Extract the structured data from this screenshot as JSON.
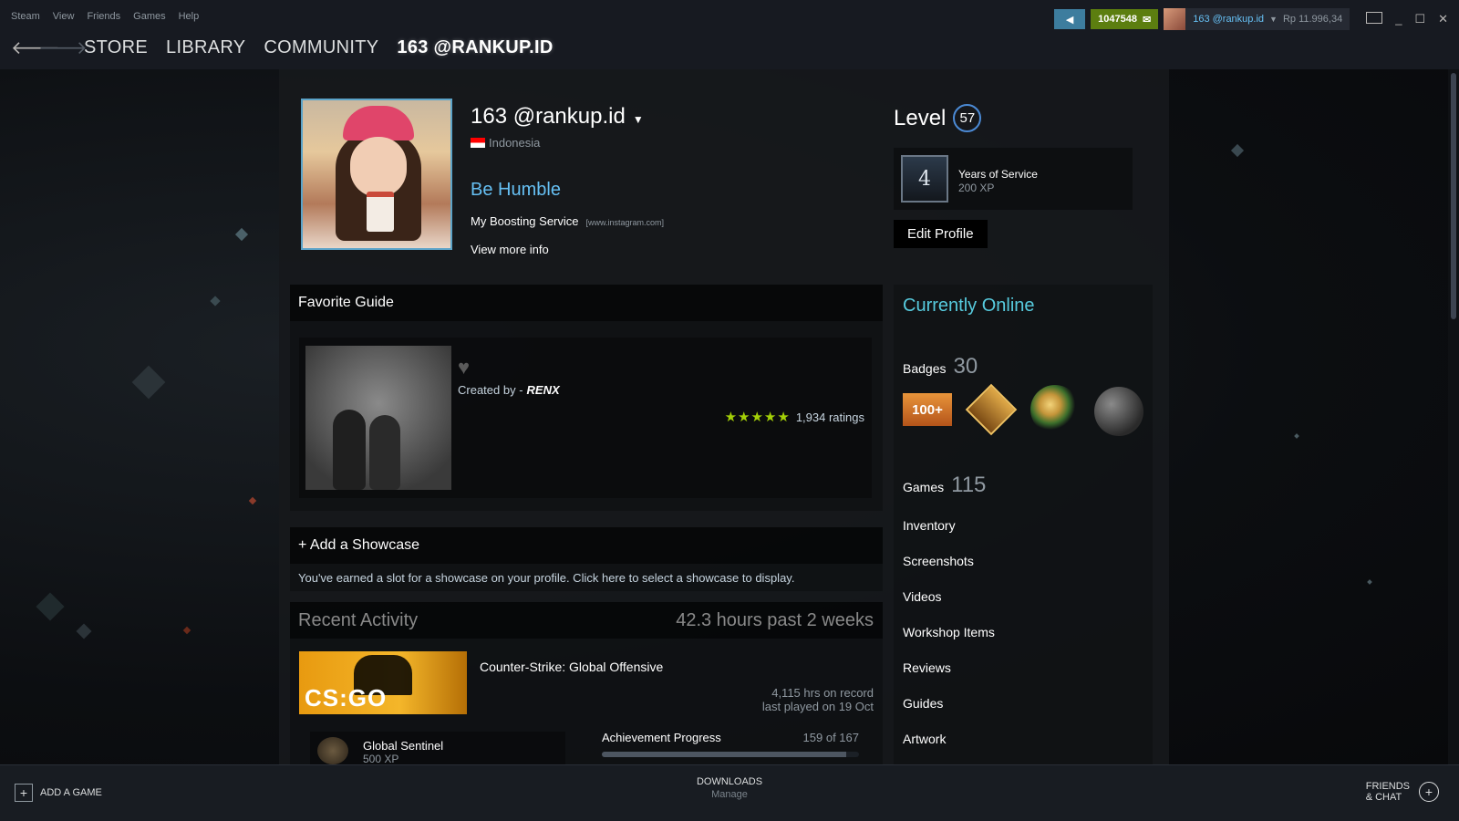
{
  "menu": [
    "Steam",
    "View",
    "Friends",
    "Games",
    "Help"
  ],
  "nav": {
    "back": "🡐",
    "forward": "🡒",
    "tabs": [
      "STORE",
      "LIBRARY",
      "COMMUNITY",
      "163 @RANKUP.ID"
    ]
  },
  "topright": {
    "notifications": "1047548",
    "account_name": "163 @rankup.id",
    "balance": "Rp 11.996,34"
  },
  "profile": {
    "name": "163 @rankup.id",
    "country": "Indonesia",
    "summary_title": "Be Humble",
    "summary_line": "My Boosting Service",
    "summary_link": "[www.instagram.com]",
    "view_more": "View more info",
    "level_label": "Level",
    "level": "57",
    "yos_number": "4",
    "yos_title": "Years of Service",
    "yos_xp": "200 XP",
    "edit_profile": "Edit Profile"
  },
  "favorite_guide": {
    "header": "Favorite Guide",
    "created_by": "Created by -",
    "author": "RENX",
    "stars": "★★★★★",
    "ratings": "1,934 ratings"
  },
  "showcase": {
    "header": "+ Add a Showcase",
    "body": "You've earned a slot for a showcase on your profile. Click here to select a showcase to display."
  },
  "recent": {
    "header": "Recent Activity",
    "hours": "42.3 hours past 2 weeks",
    "game_logo": "CS:GO",
    "game_name": "Counter-Strike: Global Offensive",
    "hrs_on_record": "4,115 hrs on record",
    "last_played": "last played on 19 Oct",
    "badge_name": "Global Sentinel",
    "badge_xp": "500 XP",
    "ach_label": "Achievement Progress",
    "ach_count": "159 of 167",
    "ach_fraction": 0.952
  },
  "sidebar": {
    "online": "Currently Online",
    "badges_label": "Badges",
    "badges_count": "30",
    "badge_1_text": "100+",
    "games_label": "Games",
    "games_count": "115",
    "links": [
      "Inventory",
      "Screenshots",
      "Videos",
      "Workshop Items",
      "Reviews",
      "Guides",
      "Artwork"
    ]
  },
  "footer": {
    "add_game": "ADD A GAME",
    "downloads": "DOWNLOADS",
    "manage": "Manage",
    "friends_line1": "FRIENDS",
    "friends_line2": "& CHAT"
  }
}
